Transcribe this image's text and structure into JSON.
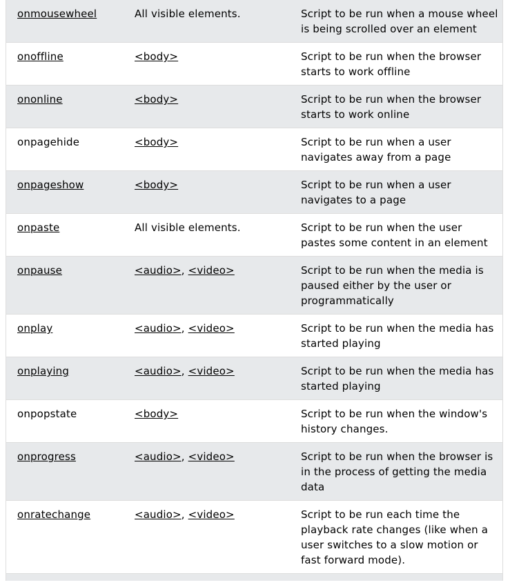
{
  "rows": [
    {
      "attribute": "onmousewheel",
      "attribute_link": true,
      "elements": [],
      "elements_text": "All visible elements.",
      "description": "Script to be run when a mouse wheel is being scrolled over an element"
    },
    {
      "attribute": "onoffline",
      "attribute_link": true,
      "elements": [
        "<body>"
      ],
      "elements_text": "",
      "description": "Script to be run when the browser starts to work offline"
    },
    {
      "attribute": "ononline",
      "attribute_link": true,
      "elements": [
        "<body>"
      ],
      "elements_text": "",
      "description": "Script to be run when the browser starts to work online"
    },
    {
      "attribute": "onpagehide",
      "attribute_link": false,
      "elements": [
        "<body>"
      ],
      "elements_text": "",
      "description": "Script to be run when a user navigates away from a page"
    },
    {
      "attribute": "onpageshow",
      "attribute_link": true,
      "elements": [
        "<body>"
      ],
      "elements_text": "",
      "description": "Script to be run when a user navigates to a page"
    },
    {
      "attribute": "onpaste",
      "attribute_link": true,
      "elements": [],
      "elements_text": "All visible elements.",
      "description": "Script to be run when the user pastes some content in an element"
    },
    {
      "attribute": "onpause",
      "attribute_link": true,
      "elements": [
        "<audio>",
        "<video>"
      ],
      "elements_text": "",
      "description": "Script to be run when the media is paused either by the user or programmatically"
    },
    {
      "attribute": "onplay",
      "attribute_link": true,
      "elements": [
        "<audio>",
        "<video>"
      ],
      "elements_text": "",
      "description": "Script to be run when the media has started playing"
    },
    {
      "attribute": "onplaying",
      "attribute_link": true,
      "elements": [
        "<audio>",
        "<video>"
      ],
      "elements_text": "",
      "description": "Script to be run when the media has started playing"
    },
    {
      "attribute": "onpopstate",
      "attribute_link": false,
      "elements": [
        "<body>"
      ],
      "elements_text": "",
      "description": "Script to be run when the window's history changes."
    },
    {
      "attribute": "onprogress",
      "attribute_link": true,
      "elements": [
        "<audio>",
        "<video>"
      ],
      "elements_text": "",
      "description": "Script to be run when the browser is in the process of getting the media data"
    },
    {
      "attribute": "onratechange",
      "attribute_link": true,
      "elements": [
        "<audio>",
        "<video>"
      ],
      "elements_text": "",
      "description": "Script to be run each time the playback rate changes (like when a user switches to a slow motion or fast forward mode)."
    }
  ],
  "element_separator": ", "
}
